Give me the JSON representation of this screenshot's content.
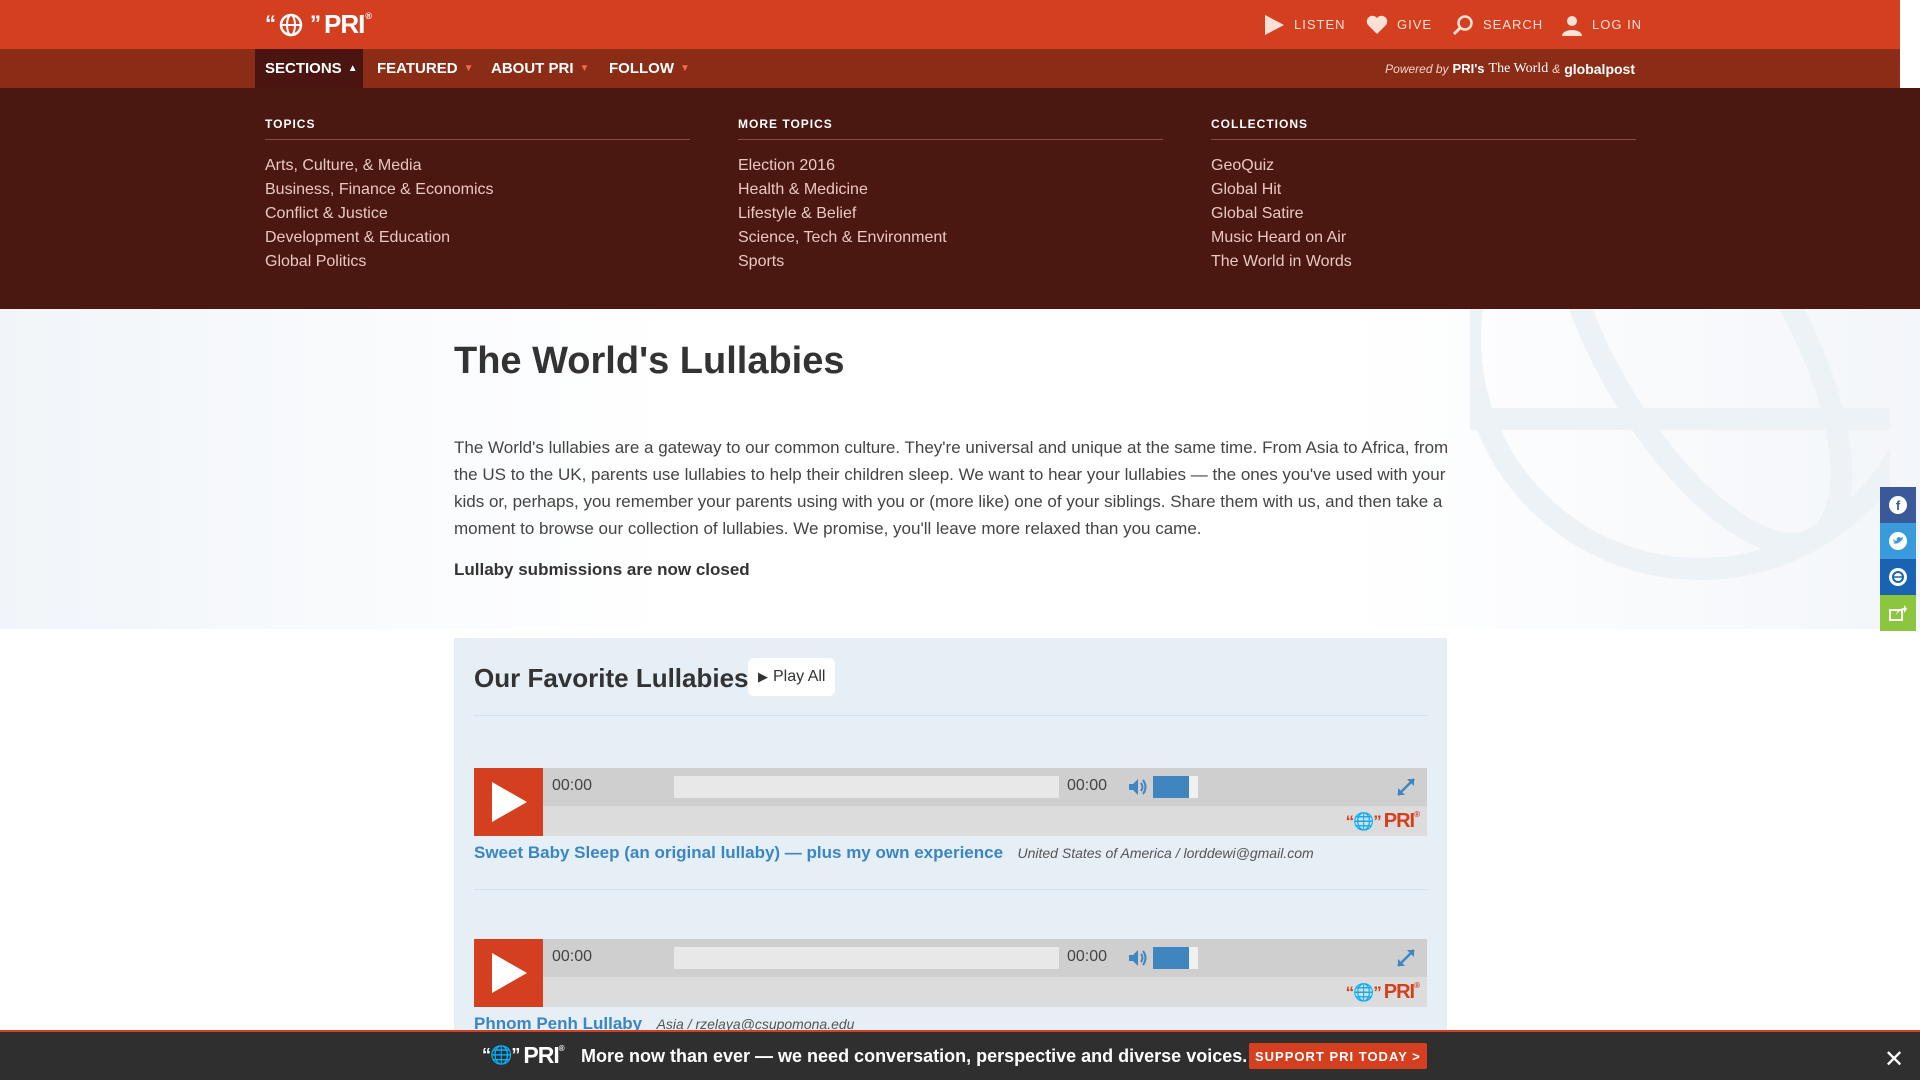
{
  "header": {
    "logo_text": "PRI",
    "utility": {
      "listen": "LISTEN",
      "give": "GIVE",
      "search": "SEARCH",
      "login": "LOG IN"
    }
  },
  "nav": {
    "items": [
      {
        "label": "SECTIONS"
      },
      {
        "label": "FEATURED"
      },
      {
        "label": "ABOUT PRI"
      },
      {
        "label": "FOLLOW"
      }
    ],
    "powered_by": "Powered by",
    "powered_pri": "PRI's",
    "powered_world": "The World",
    "powered_amp": "&",
    "powered_gp": "globalpost"
  },
  "mega_menu": {
    "topics": {
      "heading": "TOPICS",
      "items": [
        "Arts, Culture, & Media",
        "Business, Finance & Economics",
        "Conflict & Justice",
        "Development & Education",
        "Global Politics"
      ]
    },
    "more_topics": {
      "heading": "MORE TOPICS",
      "items": [
        "Election 2016",
        "Health & Medicine",
        "Lifestyle & Belief",
        "Science, Tech & Environment",
        "Sports"
      ]
    },
    "collections": {
      "heading": "COLLECTIONS",
      "items": [
        "GeoQuiz",
        "Global Hit",
        "Global Satire",
        "Music Heard on Air",
        "The World in Words"
      ]
    }
  },
  "page": {
    "title": "The World's Lullabies",
    "description": "The World's lullabies are a gateway to our common culture. They're universal and unique at the same time. From Asia to Africa, from the US to the UK, parents use lullabies to help their children sleep. We want to hear your lullabies — the ones you've used with your kids or, perhaps, you remember your parents using with you or (more like) one of your siblings. Share them with us, and then take a moment to browse our collection of lullabies. We promise, you'll leave more relaxed than you came.",
    "closed_notice": "Lullaby submissions are now closed"
  },
  "favorites": {
    "heading": "Our Favorite Lullabies",
    "play_all": "Play All",
    "tracks": [
      {
        "time_current": "00:00",
        "time_total": "00:00",
        "volume": 0.8,
        "brand": "PRI",
        "title": "Sweet Baby Sleep (an original lullaby) — plus my own experience",
        "meta": "United States of America / lorddewi@gmail.com"
      },
      {
        "time_current": "00:00",
        "time_total": "00:00",
        "volume": 0.8,
        "brand": "PRI",
        "title": "Phnom Penh Lullaby",
        "meta": "Asia / rzelaya@csupomona.edu"
      }
    ]
  },
  "banner": {
    "logo_text": "PRI",
    "message": "More now than ever — we need conversation, perspective and diverse voices.",
    "support_label": "SUPPORT PRI TODAY >"
  },
  "colors": {
    "brand_red": "#d4401f",
    "nav_dark": "#8b2c16",
    "mega_bg": "#4a1711",
    "link_blue": "#3a86c4",
    "share_facebook": "#3b5998",
    "share_twitter": "#3a9bdc",
    "share_other": "#1a63b3",
    "share_green": "#8cc63f"
  }
}
